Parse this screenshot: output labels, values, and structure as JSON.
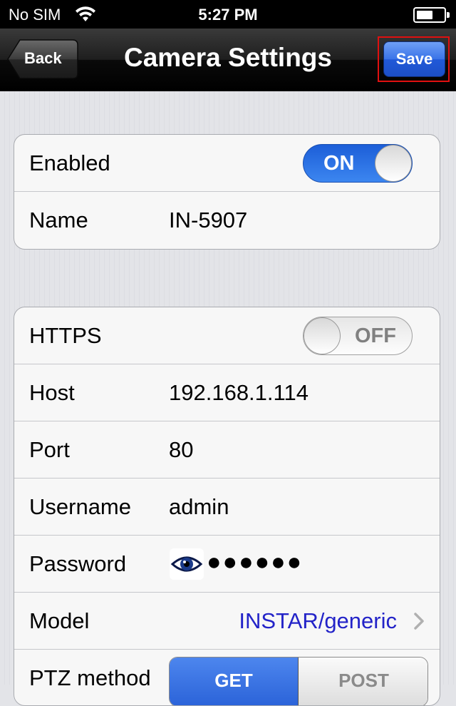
{
  "status_bar": {
    "carrier": "No SIM",
    "time": "5:27 PM",
    "icons": [
      "wifi-icon",
      "battery-icon"
    ]
  },
  "nav": {
    "back_label": "Back",
    "title": "Camera Settings",
    "save_label": "Save"
  },
  "group1": {
    "enabled": {
      "label": "Enabled",
      "toggle_text": "ON",
      "state": true
    },
    "name": {
      "label": "Name",
      "value": "IN-5907"
    }
  },
  "group2": {
    "https": {
      "label": "HTTPS",
      "toggle_text": "OFF",
      "state": false
    },
    "host": {
      "label": "Host",
      "value": "192.168.1.114"
    },
    "port": {
      "label": "Port",
      "value": "80"
    },
    "username": {
      "label": "Username",
      "value": "admin"
    },
    "password": {
      "label": "Password",
      "masked_value": "●●●●●●",
      "icon": "eye-icon"
    },
    "model": {
      "label": "Model",
      "value": "INSTAR/generic",
      "icon": "chevron-right-icon"
    },
    "ptz": {
      "label": "PTZ method",
      "options": [
        "GET",
        "POST"
      ],
      "selected": "GET"
    }
  },
  "colors": {
    "toggle_on": "#2f74e6",
    "save_button": "#2f66e0",
    "link": "#2323c8",
    "highlight_box": "#e01010"
  }
}
